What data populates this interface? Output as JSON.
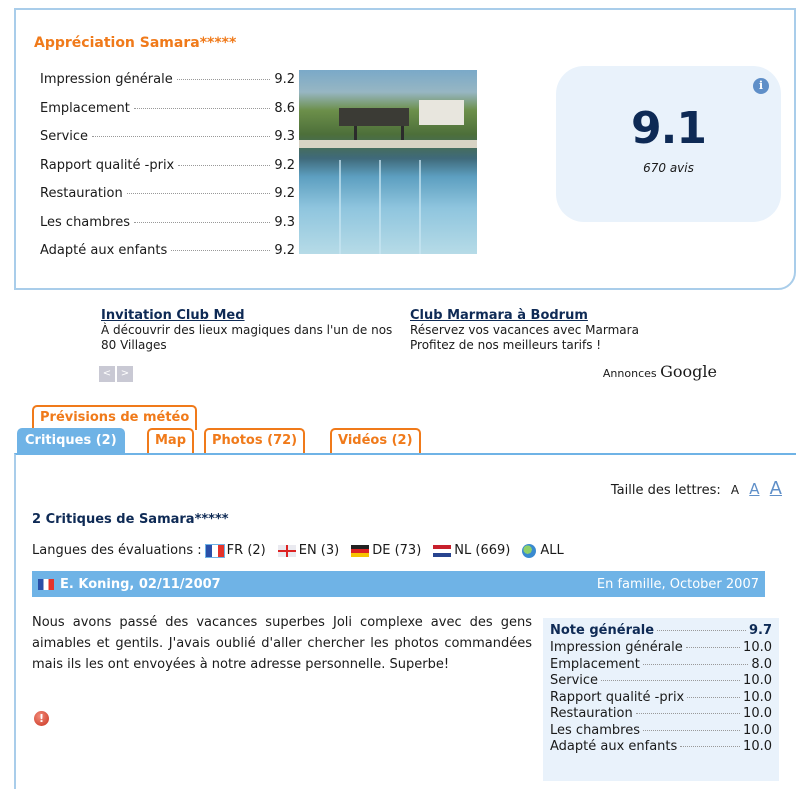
{
  "rating": {
    "title": "Appréciation Samara*****",
    "criteria": [
      {
        "label": "Impression générale",
        "value": "9.2"
      },
      {
        "label": "Emplacement",
        "value": "8.6"
      },
      {
        "label": "Service",
        "value": "9.3"
      },
      {
        "label": "Rapport qualité -prix",
        "value": "9.2"
      },
      {
        "label": "Restauration",
        "value": "9.2"
      },
      {
        "label": "Les chambres",
        "value": "9.3"
      },
      {
        "label": "Adapté aux enfants",
        "value": "9.2"
      }
    ],
    "score": "9.1",
    "review_count": "670 avis",
    "info_icon": "i"
  },
  "ads": {
    "left": {
      "title": "Invitation Club Med",
      "text": "À découvrir des lieux magiques dans l'un de nos 80 Villages"
    },
    "right": {
      "title": "Club Marmara à Bodrum",
      "line1": "Réservez vos vacances avec Marmara",
      "line2": "Profitez de nos meilleurs tarifs !"
    },
    "prev": "<",
    "next": ">",
    "annonces": "Annonces",
    "google": "Google"
  },
  "tabs": {
    "weather": "Prévisions de météo",
    "critiques": "Critiques (2)",
    "map": "Map",
    "photos": "Photos (72)",
    "videos": "Vidéos (2)"
  },
  "font_size": {
    "label": "Taille des lettres:",
    "small": "A",
    "medium": "A",
    "large": "A"
  },
  "reviews": {
    "heading": "2 Critiques de Samara*****",
    "languages_label": "Langues des évaluations :",
    "languages": {
      "fr": "FR (2)",
      "en": "EN (3)",
      "de": "DE (73)",
      "nl": "NL (669)",
      "all": "ALL"
    }
  },
  "review": {
    "author_date": "E. Koning, 02/11/2007",
    "trip": "En famille, October 2007",
    "text": "Nous avons passé des vacances superbes Joli complexe avec des gens aimables et gentils. J'avais oublié d'aller chercher les photos commandées mais ils les ont envoyées à notre adresse personnelle. Superbe!",
    "report_icon": "!",
    "overall_label": "Note générale",
    "overall_value": "9.7",
    "scores": [
      {
        "label": "Impression générale",
        "value": "10.0"
      },
      {
        "label": "Emplacement",
        "value": "8.0"
      },
      {
        "label": "Service",
        "value": "10.0"
      },
      {
        "label": "Rapport qualité -prix",
        "value": "10.0"
      },
      {
        "label": "Restauration",
        "value": "10.0"
      },
      {
        "label": "Les chambres",
        "value": "10.0"
      },
      {
        "label": "Adapté aux enfants",
        "value": "10.0"
      }
    ]
  },
  "colors": {
    "accent_orange": "#f07a1a",
    "tab_blue": "#6fb3e6",
    "navy": "#0e2a55",
    "panel_bg": "#e9f2fb"
  }
}
